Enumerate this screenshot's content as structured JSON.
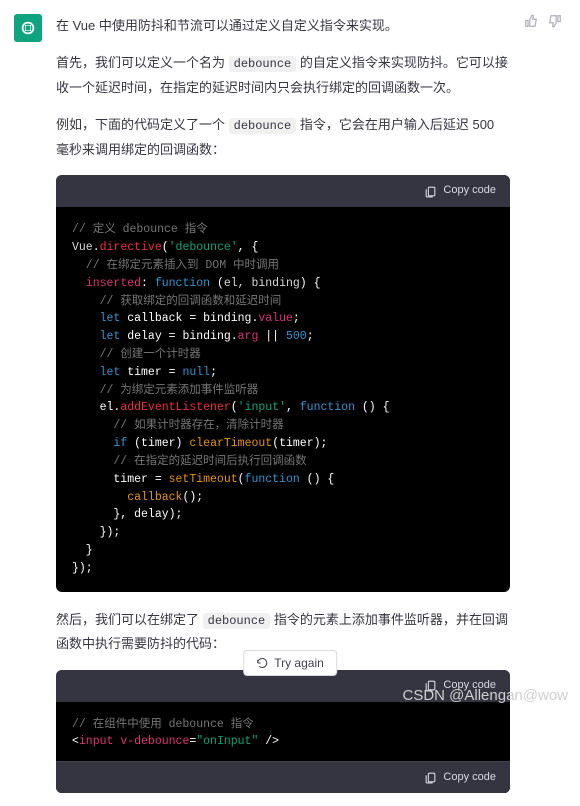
{
  "intro": "在 Vue 中使用防抖和节流可以通过定义自定义指令来实现。",
  "p1a": "首先，我们可以定义一个名为 ",
  "p1_code": "debounce",
  "p1b": " 的自定义指令来实现防抖。它可以接收一个延迟时间，在指定的延迟时间内只会执行绑定的回调函数一次。",
  "p2a": "例如，下面的代码定义了一个 ",
  "p2_code": "debounce",
  "p2b": " 指令，它会在用户输入后延迟 500 毫秒来调用绑定的回调函数：",
  "copy_label": "Copy code",
  "code1": {
    "l01": "// 定义 debounce 指令",
    "l02_a": "Vue",
    "l02_b": ".",
    "l02_c": "directive",
    "l02_d": "(",
    "l02_e": "'debounce'",
    "l02_f": ", {",
    "l03": "  // 在绑定元素插入到 DOM 中时调用",
    "l04_a": "  ",
    "l04_b": "inserted",
    "l04_c": ": ",
    "l04_d": "function",
    "l04_e": " (",
    "l04_f": "el, binding",
    "l04_g": ") {",
    "l05": "    // 获取绑定的回调函数和延迟时间",
    "l06_a": "    ",
    "l06_b": "let",
    "l06_c": " callback = binding.",
    "l06_d": "value",
    "l06_e": ";",
    "l07_a": "    ",
    "l07_b": "let",
    "l07_c": " delay = binding.",
    "l07_d": "arg",
    "l07_e": " || ",
    "l07_f": "500",
    "l07_g": ";",
    "l08": "    // 创建一个计时器",
    "l09_a": "    ",
    "l09_b": "let",
    "l09_c": " timer = ",
    "l09_d": "null",
    "l09_e": ";",
    "l10": "    // 为绑定元素添加事件监听器",
    "l11_a": "    el.",
    "l11_b": "addEventListener",
    "l11_c": "(",
    "l11_d": "'input'",
    "l11_e": ", ",
    "l11_f": "function",
    "l11_g": " () {",
    "l12": "      // 如果计时器存在，清除计时器",
    "l13_a": "      ",
    "l13_b": "if",
    "l13_c": " (timer) ",
    "l13_d": "clearTimeout",
    "l13_e": "(timer);",
    "l14": "      // 在指定的延迟时间后执行回调函数",
    "l15_a": "      timer = ",
    "l15_b": "setTimeout",
    "l15_c": "(",
    "l15_d": "function",
    "l15_e": " () {",
    "l16_a": "        ",
    "l16_b": "callback",
    "l16_c": "();",
    "l17": "      }, delay);",
    "l18": "    });",
    "l19": "  }",
    "l20": "});"
  },
  "p3a": "然后，我们可以在绑定了 ",
  "p3_code": "debounce",
  "p3b": " 指令的元素上添加事件监听器，并在回调函数中执行需要防抖的代码：",
  "code2": {
    "l1": "// 在组件中使用 debounce 指令",
    "l2_a": "<",
    "l2_b": "input",
    "l2_c": " ",
    "l2_d": "v-debounce",
    "l2_e": "=",
    "l2_f": "\"onInput\"",
    "l2_g": " />"
  },
  "try_again": "Try again",
  "watermark": "CSDN @Allengan@wow"
}
